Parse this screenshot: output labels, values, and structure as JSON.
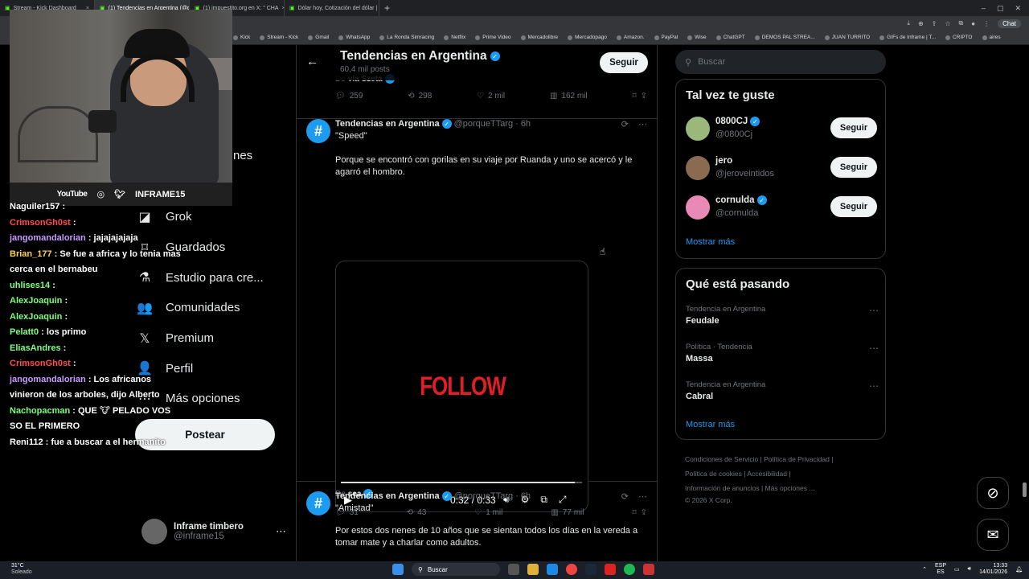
{
  "browser": {
    "tabs": [
      {
        "label": "Stream - Kick Dashboard",
        "active": false
      },
      {
        "label": "(1) Tendencias en Argentina (@po",
        "active": true
      },
      {
        "label": "(1) impuestito.org en X: \" CHA",
        "active": false
      },
      {
        "label": "Dólar hoy, Cotización del dólar | E",
        "active": false
      }
    ],
    "chat_label": "Chat",
    "bookmarks": [
      "Kick",
      "Stream - Kick",
      "Gmail",
      "WhatsApp",
      "La Ronda Simracing",
      "Netflix",
      "Prime Video",
      "Mercadolibre",
      "Mercadopago",
      "Amazon.",
      "PayPal",
      "Wise",
      "ChatGPT",
      "DEMOS PAL STREA...",
      "JUAN TURRITO",
      "GIFs de Inframe | T...",
      "CRIPTO",
      "aires"
    ]
  },
  "overlay": {
    "socials": {
      "youtube": "YouTube",
      "handle": "INFRAME15"
    },
    "chat": [
      {
        "user": "Naguiler157",
        "color": "#ffffff",
        "msg": ":"
      },
      {
        "user": "CrimsonGh0st",
        "color": "#ff4d4d",
        "msg": ":"
      },
      {
        "user": "jangomandalorian",
        "color": "#c79bff",
        "msg": ": jajajajajaja"
      },
      {
        "user": "Brian_177",
        "color": "#ffd24d",
        "msg": ": Se fue a africa y lo tenia mas cerca en el bernabeu"
      },
      {
        "user": "uhlises14",
        "color": "#7cff7c",
        "msg": ":"
      },
      {
        "user": "AlexJoaquin",
        "color": "#7cff7c",
        "msg": ":"
      },
      {
        "user": "AlexJoaquin",
        "color": "#7cff7c",
        "msg": ":"
      },
      {
        "user": "Pelatt0",
        "color": "#7cff7c",
        "msg": ": los primo"
      },
      {
        "user": "EliasAndres",
        "color": "#7cff7c",
        "msg": ":"
      },
      {
        "user": "CrimsonGh0st",
        "color": "#ff4d4d",
        "msg": ":"
      },
      {
        "user": "jangomandalorian",
        "color": "#c79bff",
        "msg": ": Los africanos vinieron de los arboles, dijo Alberto"
      },
      {
        "user": "Nachopacman",
        "color": "#7cff7c",
        "msg": ": QUE 🐮 PELADO VOS SO EL PRIMERO"
      },
      {
        "user": "Reni112",
        "color": "#ffffff",
        "msg": ": fue a buscar a el hermanito"
      }
    ]
  },
  "nav": {
    "hidden_label": "nes",
    "items": [
      {
        "label": "Grok",
        "icon": "grok-icon",
        "glyph": "◪"
      },
      {
        "label": "Guardados",
        "icon": "bookmark-icon",
        "glyph": "⌑"
      },
      {
        "label": "Estudio para cre...",
        "icon": "studio-icon",
        "glyph": "⚗"
      },
      {
        "label": "Comunidades",
        "icon": "communities-icon",
        "glyph": "👥"
      },
      {
        "label": "Premium",
        "icon": "x-logo-icon",
        "glyph": "𝕏"
      },
      {
        "label": "Perfil",
        "icon": "profile-icon",
        "glyph": "👤"
      },
      {
        "label": "Más opciones",
        "icon": "more-options-icon",
        "glyph": "⋯"
      }
    ],
    "post_button": "Postear",
    "account": {
      "name": "Inframe timbero",
      "handle": "@inframe15"
    }
  },
  "timeline": {
    "title": "Tendencias en Argentina",
    "posts_count": "60,4 mil posts",
    "follow_button": "Seguir",
    "prev_via": "vía Szeta",
    "prev_actions": {
      "replies": "259",
      "reposts": "298",
      "likes": "2 mil",
      "views": "162 mil"
    },
    "tweets": [
      {
        "author": "Tendencias en Argentina",
        "handle": "@porqueTTarg",
        "time": "6h",
        "title": "\"Speed\"",
        "body": "Porque se encontró con gorilas en su viaje por Ruanda y uno se acercó y le agarró el hombro.",
        "video": {
          "overlay_text": "FOLLOW",
          "progress": 0.97,
          "time": "0:32 / 0:33"
        },
        "via_prefix": "De",
        "via": "sea",
        "actions": {
          "replies": "31",
          "reposts": "43",
          "likes": "1 mil",
          "views": "77 mil"
        }
      },
      {
        "author": "Tendencias en Argentina",
        "handle": "@porqueTTarg",
        "time": "6h",
        "title": "\"Amistad\"",
        "body": "Por estos dos nenes de 10 años que se sientan todos los días en la vereda a tomar mate y a charlar como adultos."
      }
    ]
  },
  "sidebar": {
    "search_placeholder": "Buscar",
    "suggestions_title": "Tal vez te guste",
    "suggestions": [
      {
        "name": "0800CJ",
        "handle": "@0800Cj",
        "verified": true,
        "button": "Seguir",
        "color": "#9bb87a"
      },
      {
        "name": "jero",
        "handle": "@jeroveintidos",
        "verified": false,
        "button": "Seguir",
        "color": "#8a6b4f"
      },
      {
        "name": "cornulda",
        "handle": "@cornulda",
        "verified": true,
        "button": "Seguir",
        "color": "#e88ab5"
      }
    ],
    "show_more": "Mostrar más",
    "trends_title": "Qué está pasando",
    "trends": [
      {
        "category": "Tendencia en Argentina",
        "name": "Feudale"
      },
      {
        "category": "Política · Tendencia",
        "name": "Massa"
      },
      {
        "category": "Tendencia en Argentina",
        "name": "Cabral"
      }
    ],
    "trends_more": "Mostrar más",
    "footer": {
      "line1": "Condiciones de Servicio  |  Política de Privacidad  |",
      "line2": "Política de cookies  |  Accesibilidad  |",
      "line3": "Información de anuncios  |  Más opciones ...",
      "line4": "© 2026 X Corp."
    }
  },
  "taskbar": {
    "temp": "31°C",
    "weather": "Soleado",
    "search": "Buscar",
    "lang": "ESP",
    "lang_sub": "ES",
    "time": "13:33",
    "date": "14/01/2026"
  }
}
